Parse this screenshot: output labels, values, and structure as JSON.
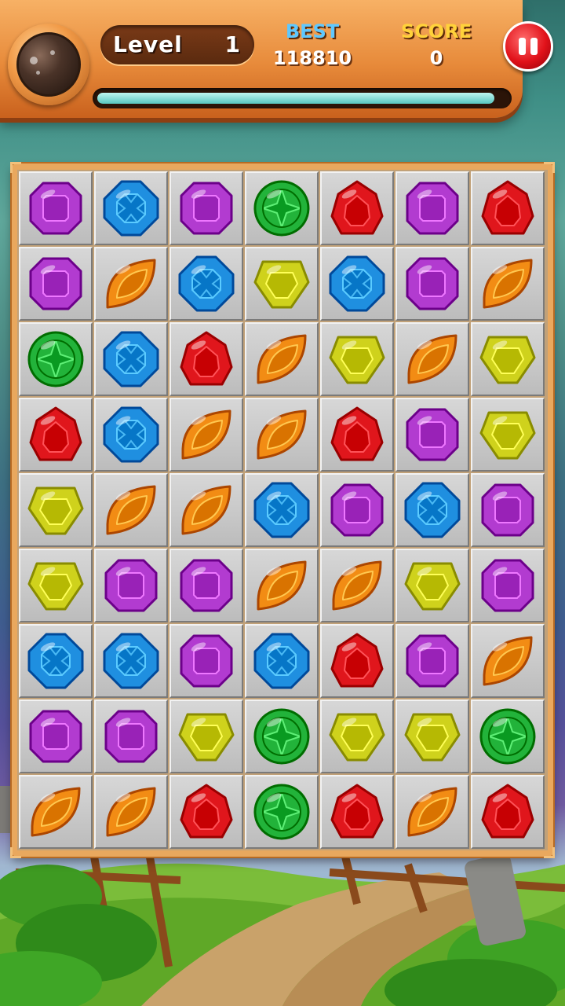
{
  "hud": {
    "level_label": "Level",
    "level": "1",
    "best_label": "BEST",
    "best_value": "118810",
    "score_label": "SCORE",
    "score_value": "0",
    "pause_icon": "pause-icon",
    "progress": 0.97
  },
  "board": {
    "rows": 9,
    "cols": 7,
    "grid": [
      [
        "purple",
        "blue",
        "purple",
        "green",
        "red",
        "purple",
        "red"
      ],
      [
        "purple",
        "orange",
        "blue",
        "yellow",
        "blue",
        "purple",
        "orange"
      ],
      [
        "green",
        "blue",
        "red",
        "orange",
        "yellow",
        "orange",
        "yellow"
      ],
      [
        "red",
        "blue",
        "orange",
        "orange",
        "red",
        "purple",
        "yellow"
      ],
      [
        "yellow",
        "orange",
        "orange",
        "blue",
        "purple",
        "blue",
        "purple"
      ],
      [
        "yellow",
        "purple",
        "purple",
        "orange",
        "orange",
        "yellow",
        "purple"
      ],
      [
        "blue",
        "blue",
        "purple",
        "blue",
        "red",
        "purple",
        "orange"
      ],
      [
        "purple",
        "purple",
        "yellow",
        "green",
        "yellow",
        "yellow",
        "green"
      ],
      [
        "orange",
        "orange",
        "red",
        "green",
        "red",
        "orange",
        "red"
      ]
    ]
  },
  "gem_colors": {
    "purple": "#b23bd0",
    "blue": "#1f8fe0",
    "green": "#22b33a",
    "red": "#e0161c",
    "orange": "#f28c14",
    "yellow": "#cfd21c"
  },
  "gem_icons": {
    "purple": "purple-square-gem-icon",
    "blue": "blue-octagon-gem-icon",
    "green": "green-round-gem-icon",
    "red": "red-drop-gem-icon",
    "orange": "orange-leaf-gem-icon",
    "yellow": "yellow-pentagon-gem-icon"
  }
}
